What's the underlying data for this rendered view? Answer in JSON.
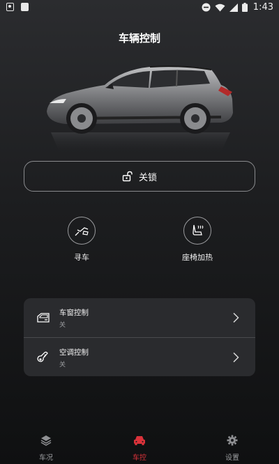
{
  "status_bar": {
    "time": "1:43"
  },
  "header": {
    "title": "车辆控制"
  },
  "lock": {
    "label": "关锁"
  },
  "quick_controls": [
    {
      "label": "寻车",
      "icon": "find-car-icon"
    },
    {
      "label": "座椅加热",
      "icon": "seat-heating-icon"
    }
  ],
  "controls": [
    {
      "title": "车窗控制",
      "status": "关",
      "icon": "window-icon"
    },
    {
      "title": "空调控制",
      "status": "关",
      "icon": "thermometer-icon"
    }
  ],
  "tabs": [
    {
      "label": "车况",
      "icon": "layers-icon",
      "active": false
    },
    {
      "label": "车控",
      "icon": "car-icon",
      "active": true
    },
    {
      "label": "设置",
      "icon": "gear-icon",
      "active": false
    }
  ],
  "colors": {
    "accent": "#d9323a",
    "background": "#1c1d1f",
    "card": "#2a2b2e"
  }
}
